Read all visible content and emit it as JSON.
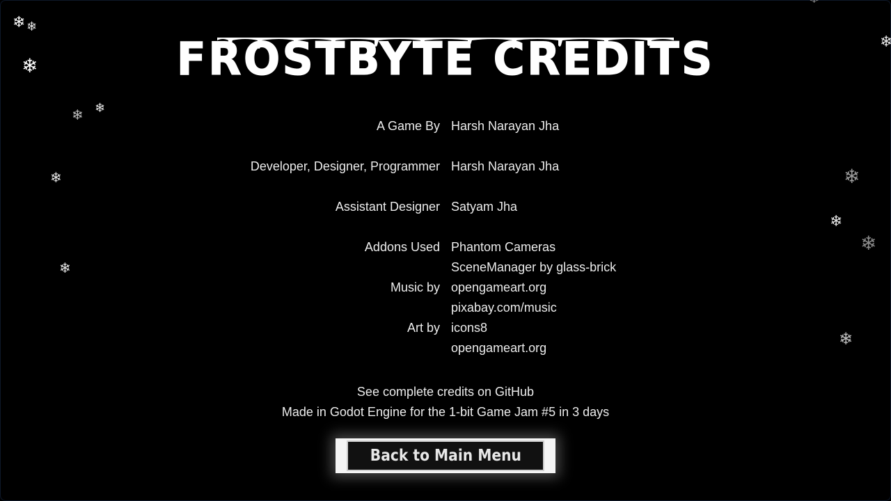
{
  "title": "Frostbyte Credits",
  "credits": [
    {
      "role": "A Game By",
      "names": [
        "Harsh Narayan Jha"
      ]
    },
    {
      "role": "Developer, Designer, Programmer",
      "names": [
        "Harsh Narayan Jha"
      ]
    },
    {
      "role": "Assistant Designer",
      "names": [
        "Satyam Jha"
      ]
    },
    {
      "role": "Addons Used",
      "names": [
        "Phantom Cameras",
        "SceneManager by glass-brick"
      ]
    },
    {
      "role": "Music by",
      "names": [
        "opengameart.org",
        "pixabay.com/music"
      ]
    },
    {
      "role": "Art by",
      "names": [
        "icons8",
        "opengameart.org"
      ]
    }
  ],
  "footer": {
    "github_line": "See complete credits on GitHub",
    "made_in_line": "Made in Godot Engine for the 1-bit Game Jam #5 in 3 days"
  },
  "back_button": {
    "label": "Back to Main Menu"
  },
  "colors": {
    "background": "#000000",
    "text": "#ececec",
    "title": "#ffffff",
    "button_frame": "#f4f4f4",
    "button_fill": "#111111"
  },
  "decor": {
    "snowflake_icon": "snowflake-icon"
  }
}
